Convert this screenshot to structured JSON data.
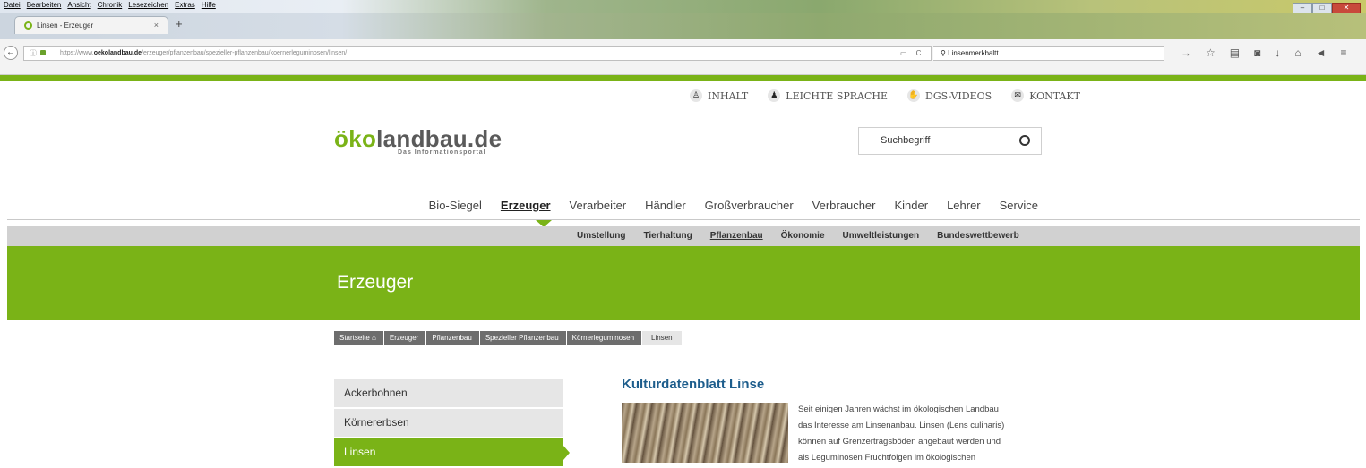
{
  "browser": {
    "menu": [
      "Datei",
      "Bearbeiten",
      "Ansicht",
      "Chronik",
      "Lesezeichen",
      "Extras",
      "Hilfe"
    ],
    "tab_title": "Linsen - Erzeuger",
    "tab_close": "×",
    "new_tab": "+",
    "url_prefix": "https://www.",
    "url_domain": "oekolandbau.de",
    "url_path": "/erzeuger/pflanzenbau/spezieller-pflanzenbau/koernerleguminosen/linsen/",
    "reload": "C",
    "search_value": "Linsenmerkbaltt"
  },
  "site": {
    "top_links": [
      "INHALT",
      "LEICHTE SPRACHE",
      "DGS-VIDEOS",
      "KONTAKT"
    ],
    "logo_prefix": "ö",
    "logo_ko": "ko",
    "logo_rest": "landbau.de",
    "logo_sub": "Das Informationsportal",
    "search_placeholder": "Suchbegriff",
    "main_nav": [
      "Bio-Siegel",
      "Erzeuger",
      "Verarbeiter",
      "Händler",
      "Großverbraucher",
      "Verbraucher",
      "Kinder",
      "Lehrer",
      "Service"
    ],
    "sub_nav": [
      "Umstellung",
      "Tierhaltung",
      "Pflanzenbau",
      "Ökonomie",
      "Umweltleistungen",
      "Bundeswettbewerb"
    ],
    "hero_title": "Erzeuger",
    "breadcrumbs": [
      "Startseite",
      "Erzeuger",
      "Pflanzenbau",
      "Spezieller Pflanzenbau",
      "Körnerleguminosen"
    ],
    "breadcrumb_current": "Linsen",
    "sidebar": [
      "Ackerbohnen",
      "Körnererbsen",
      "Linsen"
    ],
    "article_title": "Kulturdatenblatt Linse",
    "article_lines": [
      "Seit einigen Jahren wächst im ökologischen Landbau",
      "das Interesse am Linsenanbau. Linsen (Lens culinaris)",
      "können auf Grenzertragsböden angebaut werden und",
      "als Leguminosen Fruchtfolgen im ökologischen"
    ],
    "accent_color": "#7ab317",
    "title_color": "#1d5d8c"
  }
}
